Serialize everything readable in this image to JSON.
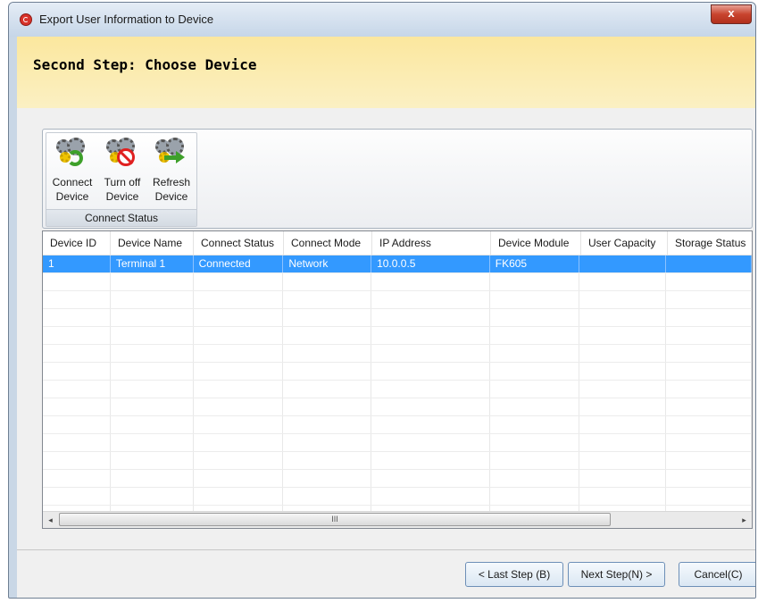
{
  "window": {
    "title": "Export User Information to Device",
    "close_glyph": "x"
  },
  "header": {
    "title": "Second Step: Choose Device"
  },
  "ribbon": {
    "group_label": "Connect Status",
    "buttons": [
      {
        "line1": "Connect",
        "line2": "Device",
        "icon": "connect-device-icon"
      },
      {
        "line1": "Turn off",
        "line2": "Device",
        "icon": "turn-off-device-icon"
      },
      {
        "line1": "Refresh",
        "line2": "Device",
        "icon": "refresh-device-icon"
      }
    ]
  },
  "table": {
    "columns": [
      "Device ID",
      "Device Name",
      "Connect Status",
      "Connect Mode",
      "IP Address",
      "Device Module",
      "User Capacity",
      "Storage Status"
    ],
    "rows": [
      [
        "1",
        "Terminal 1",
        "Connected",
        "Network",
        "10.0.0.5",
        "FK605",
        "",
        ""
      ]
    ],
    "scroll_left_glyph": "◂",
    "scroll_right_glyph": "▸",
    "scroll_thumb_glyph": "III"
  },
  "footer": {
    "prev_label": "< Last Step (B)",
    "next_label": "Next Step(N) >",
    "cancel_label": "Cancel(C)"
  }
}
